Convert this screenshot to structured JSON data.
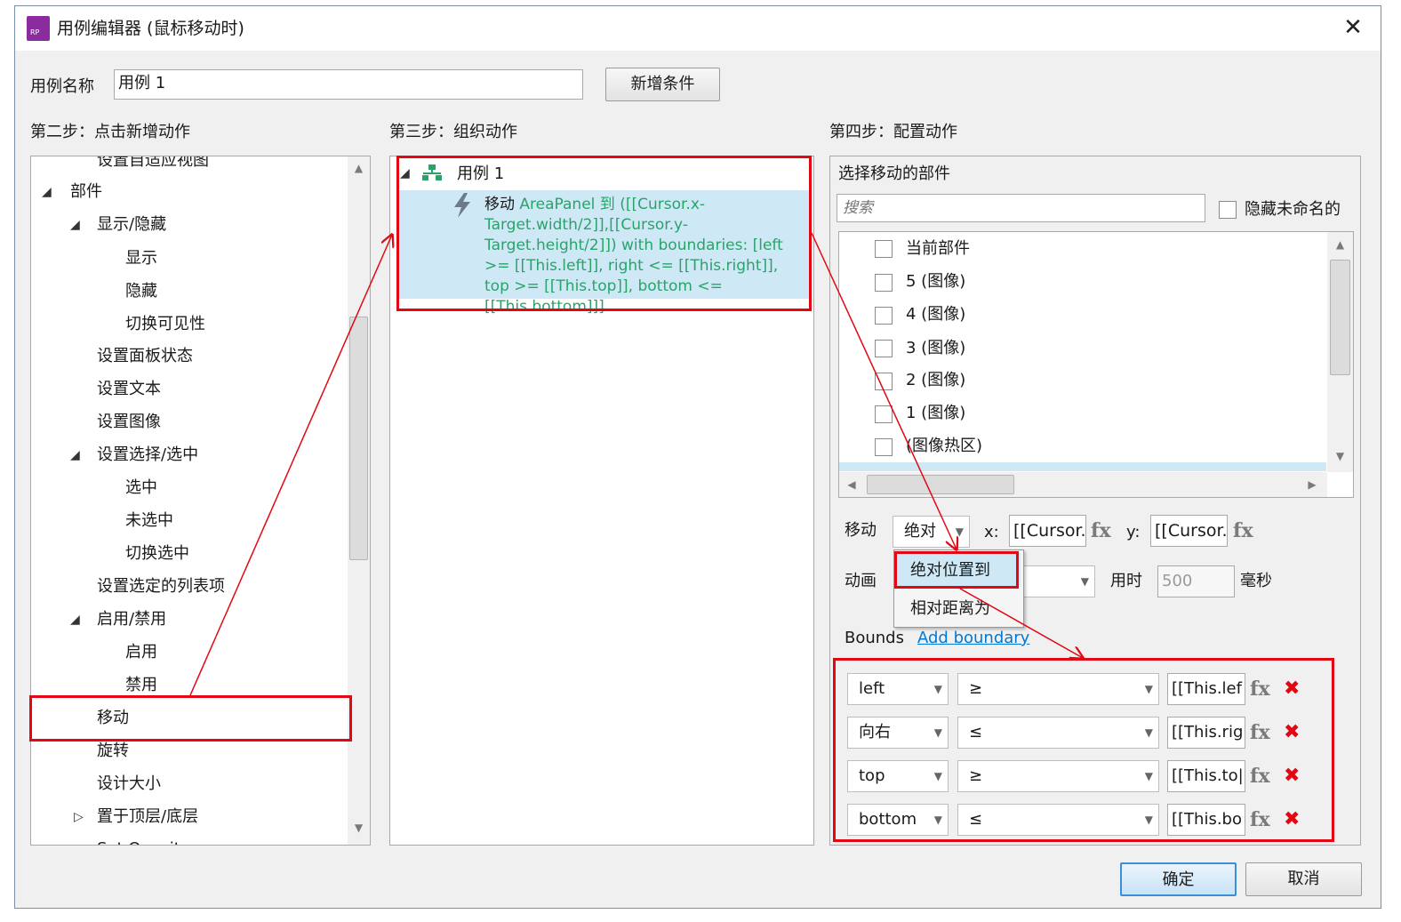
{
  "window": {
    "title": "用例编辑器 (鼠标移动时)",
    "logo_text": "RP",
    "close_glyph": "✕"
  },
  "case": {
    "name_label": "用例名称",
    "name_value": "用例 1",
    "add_condition": "新增条件"
  },
  "step2": {
    "heading": "第二步：点击新增动作",
    "items": [
      {
        "label": "设置自适应视图",
        "toggle": ""
      },
      {
        "label": "部件",
        "toggle": "◢"
      },
      {
        "label": "显示/隐藏",
        "toggle": "◢"
      },
      {
        "label": "显示",
        "toggle": ""
      },
      {
        "label": "隐藏",
        "toggle": ""
      },
      {
        "label": "切换可见性",
        "toggle": ""
      },
      {
        "label": "设置面板状态",
        "toggle": ""
      },
      {
        "label": "设置文本",
        "toggle": ""
      },
      {
        "label": "设置图像",
        "toggle": ""
      },
      {
        "label": "设置选择/选中",
        "toggle": "◢"
      },
      {
        "label": "选中",
        "toggle": ""
      },
      {
        "label": "未选中",
        "toggle": ""
      },
      {
        "label": "切换选中",
        "toggle": ""
      },
      {
        "label": "设置选定的列表项",
        "toggle": ""
      },
      {
        "label": "启用/禁用",
        "toggle": "◢"
      },
      {
        "label": "启用",
        "toggle": ""
      },
      {
        "label": "禁用",
        "toggle": ""
      },
      {
        "label": "移动",
        "toggle": ""
      },
      {
        "label": "旋转",
        "toggle": ""
      },
      {
        "label": "设计大小",
        "toggle": ""
      },
      {
        "label": "置于顶层/底层",
        "toggle": "▷"
      },
      {
        "label": "Set Opacity",
        "toggle": ""
      }
    ]
  },
  "step3": {
    "heading": "第三步：组织动作",
    "case_label": "用例 1",
    "action_prefix": "移动",
    "action_text": "AreaPanel 到 ([[Cursor.x-Target.width/2]],[[Cursor.y-Target.height/2]]) with boundaries: [left >= [[This.left]], right <= [[This.right]], top >= [[This.top]], bottom <= [[This.bottom]]]"
  },
  "step4": {
    "heading": "第四步：配置动作",
    "select_label": "选择移动的部件",
    "search_placeholder": "搜索",
    "hide_unnamed": "隐藏未命名的",
    "widgets": [
      "当前部件",
      "5 (图像)",
      "4 (图像)",
      "3 (图像)",
      "2 (图像)",
      "1 (图像)",
      "(图像热区)"
    ],
    "move_label": "移动",
    "move_mode": "绝对",
    "x_label": "x:",
    "x_value": "[[Cursor.",
    "y_label": "y:",
    "y_value": "[[Cursor.",
    "fx": "fx",
    "anim_label": "动画",
    "duration_label": "用时",
    "duration_value": "500",
    "ms_label": "毫秒",
    "dropdown_options": [
      "绝对位置到",
      "相对距离为"
    ],
    "bounds_label": "Bounds",
    "add_boundary": "Add boundary",
    "boundaries": [
      {
        "side": "left",
        "op": "≥",
        "value": "[[This.lef"
      },
      {
        "side": "向右",
        "op": "≤",
        "value": "[[This.rig"
      },
      {
        "side": "top",
        "op": "≥",
        "value": "[[This.to|"
      },
      {
        "side": "bottom",
        "op": "≤",
        "value": "[[This.bo"
      }
    ],
    "delete_glyph": "✖"
  },
  "footer": {
    "ok": "确定",
    "cancel": "取消"
  },
  "colors": {
    "highlight": "#e30613",
    "selection": "#cfe8f6",
    "action_text": "#2aa36a",
    "link": "#0078d7"
  }
}
